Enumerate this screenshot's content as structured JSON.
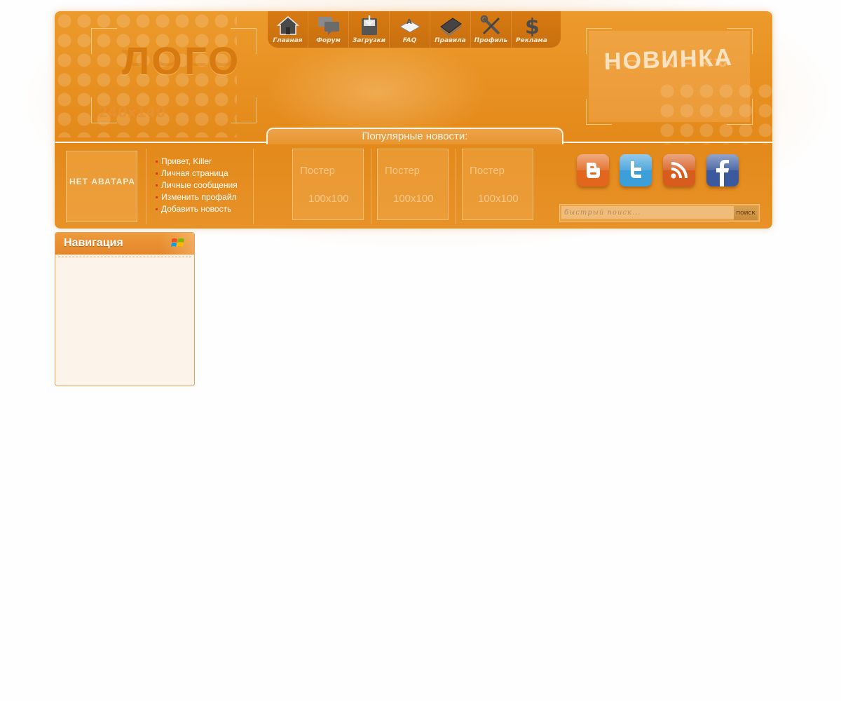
{
  "logo": {
    "text": "ЛОГО",
    "size": "240x140"
  },
  "top_menu": [
    {
      "label": "Главная",
      "icon": "home-icon"
    },
    {
      "label": "Форум",
      "icon": "chat-bubbles-icon"
    },
    {
      "label": "Загрузки",
      "icon": "download-icon"
    },
    {
      "label": "FAQ",
      "icon": "faq-icon"
    },
    {
      "label": "Правила",
      "icon": "books-icon"
    },
    {
      "label": "Профиль",
      "icon": "tools-icon"
    },
    {
      "label": "Реклама",
      "icon": "dollar-icon"
    }
  ],
  "new_banner": {
    "text": "НОВИНКА"
  },
  "popular": {
    "title": "Популярные новости:"
  },
  "avatar": {
    "text": "НЕТ АВАТАРА"
  },
  "user_menu": [
    "Привет, Killer",
    "Личная страница",
    "Личные сообщения",
    "Изменить профайл",
    "Добавить новость"
  ],
  "posters": [
    {
      "title": "Постер",
      "size": "100x100"
    },
    {
      "title": "Постер",
      "size": "100x100"
    },
    {
      "title": "Постер",
      "size": "100x100"
    }
  ],
  "social": [
    {
      "name": "blogger-icon",
      "color": "#e2661b"
    },
    {
      "name": "twitter-icon",
      "color": "#3d9fd9"
    },
    {
      "name": "rss-icon",
      "color": "#d85c1e"
    },
    {
      "name": "facebook-icon",
      "color": "#3b5a9e"
    }
  ],
  "search": {
    "placeholder": "быстрый поиск...",
    "button": "поиск"
  },
  "navigation": {
    "title": "Навигация"
  },
  "colors": {
    "accent": "#e4891a",
    "panel": "#fcf3ea",
    "border": "#e8a25b"
  }
}
